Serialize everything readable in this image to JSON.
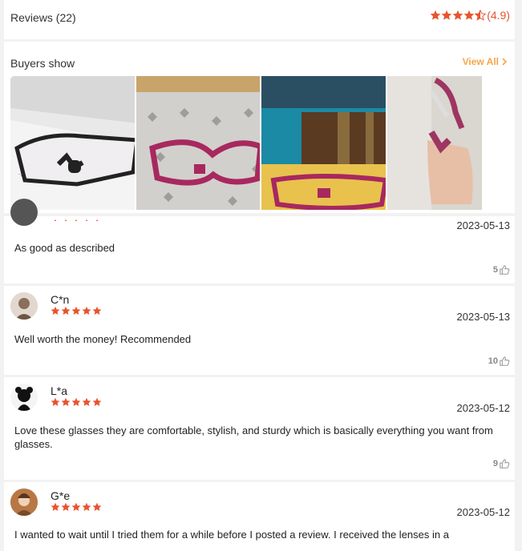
{
  "header": {
    "title": "Reviews (22)",
    "score": "(4.9)",
    "star_color": "#e8542e"
  },
  "buyers": {
    "title": "Buyers show",
    "view_all": "View All",
    "accent": "#f5a64a",
    "photos": [
      "photo-1",
      "photo-2",
      "photo-3",
      "photo-4"
    ]
  },
  "reviews": [
    {
      "name": "",
      "date": "2023-05-13",
      "text": "As good as described",
      "likes": "5"
    },
    {
      "name": "C*n",
      "date": "2023-05-13",
      "text": "Well worth the money! Recommended",
      "likes": "10"
    },
    {
      "name": "L*a",
      "date": "2023-05-12",
      "text": "Love these glasses they are comfortable, stylish, and sturdy which is basically everything you want from glasses.",
      "likes": "9"
    },
    {
      "name": "G*e",
      "date": "2023-05-12",
      "text": "I wanted to wait until I tried them for a while before I posted a review. I received the lenses in a",
      "likes": ""
    }
  ]
}
